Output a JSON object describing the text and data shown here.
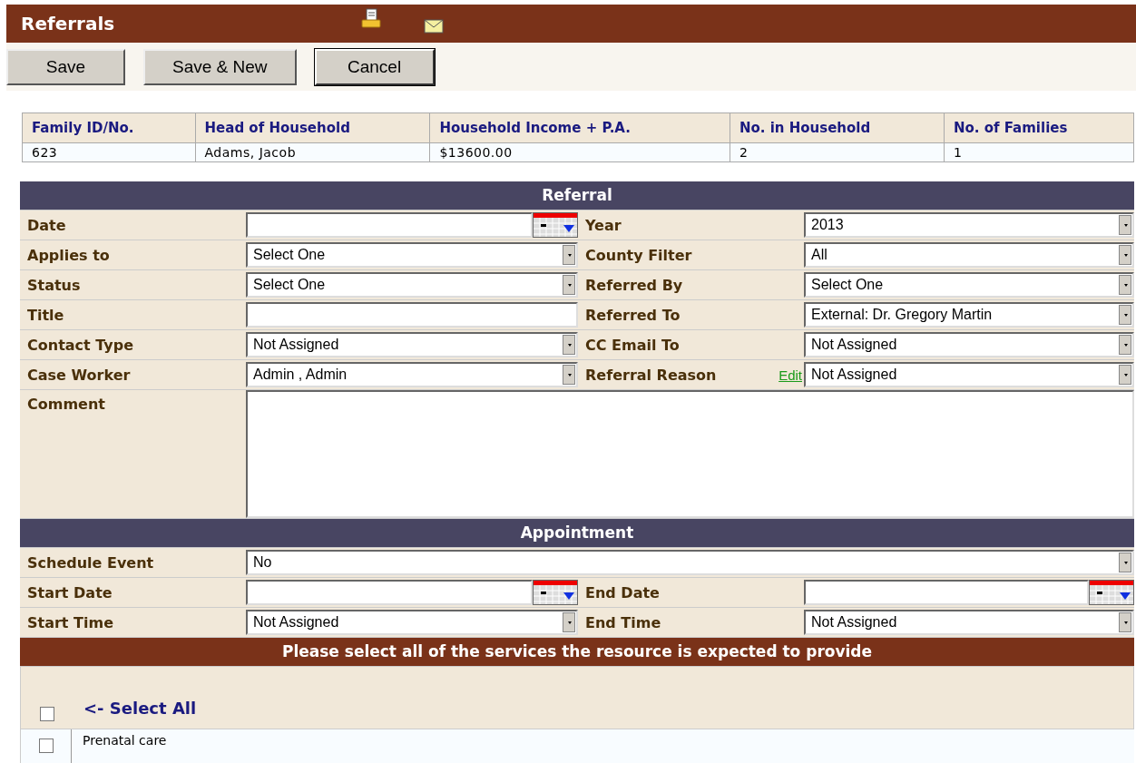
{
  "header": {
    "title": "Referrals"
  },
  "toolbar": {
    "buttons": [
      {
        "label": "Save",
        "selected": false
      },
      {
        "label": "Save & New",
        "selected": false
      },
      {
        "label": "Cancel",
        "selected": true
      }
    ]
  },
  "household": {
    "columns": [
      "Family ID/No.",
      "Head of Household",
      "Household Income + P.A.",
      "No. in Household",
      "No. of Families"
    ],
    "row": [
      "623",
      "Adams, Jacob",
      "$13600.00",
      "2",
      "1"
    ]
  },
  "referral": {
    "title": "Referral",
    "rows": [
      {
        "left": {
          "label": "Date",
          "kind": "date"
        },
        "right": {
          "label": "Year",
          "kind": "select",
          "value": "2013"
        }
      },
      {
        "left": {
          "label": "Applies to",
          "kind": "select",
          "value": "Select One"
        },
        "right": {
          "label": "County Filter",
          "kind": "select",
          "value": "All"
        }
      },
      {
        "left": {
          "label": "Status",
          "kind": "select",
          "value": "Select One"
        },
        "right": {
          "label": "Referred By",
          "kind": "select",
          "value": "Select One"
        }
      },
      {
        "left": {
          "label": "Title",
          "kind": "text"
        },
        "right": {
          "label": "Referred To",
          "kind": "select",
          "value": "External: Dr. Gregory Martin"
        }
      },
      {
        "left": {
          "label": "Contact Type",
          "kind": "select",
          "value": "Not Assigned"
        },
        "right": {
          "label": "CC Email To",
          "kind": "select",
          "value": "Not Assigned"
        }
      },
      {
        "left": {
          "label": "Case Worker",
          "kind": "select",
          "value": "Admin , Admin"
        },
        "right": {
          "label": "Referral Reason",
          "kind": "select",
          "value": "Not Assigned",
          "link": "Edit"
        }
      }
    ],
    "comment": {
      "label": "Comment"
    }
  },
  "appointment": {
    "title": "Appointment",
    "schedule_event": {
      "label": "Schedule Event",
      "value": "No"
    },
    "rows": [
      {
        "left": {
          "label": "Start Date",
          "kind": "date"
        },
        "right": {
          "label": "End Date",
          "kind": "date"
        }
      },
      {
        "left": {
          "label": "Start Time",
          "kind": "select",
          "value": "Not Assigned"
        },
        "right": {
          "label": "End Time",
          "kind": "select",
          "value": "Not Assigned"
        }
      }
    ]
  },
  "services": {
    "title": "Please select all of the services the resource is expected to provide",
    "select_all": {
      "label": "<- Select All",
      "checked": false
    },
    "items": [
      {
        "label": "Prenatal care",
        "checked": false
      }
    ]
  }
}
